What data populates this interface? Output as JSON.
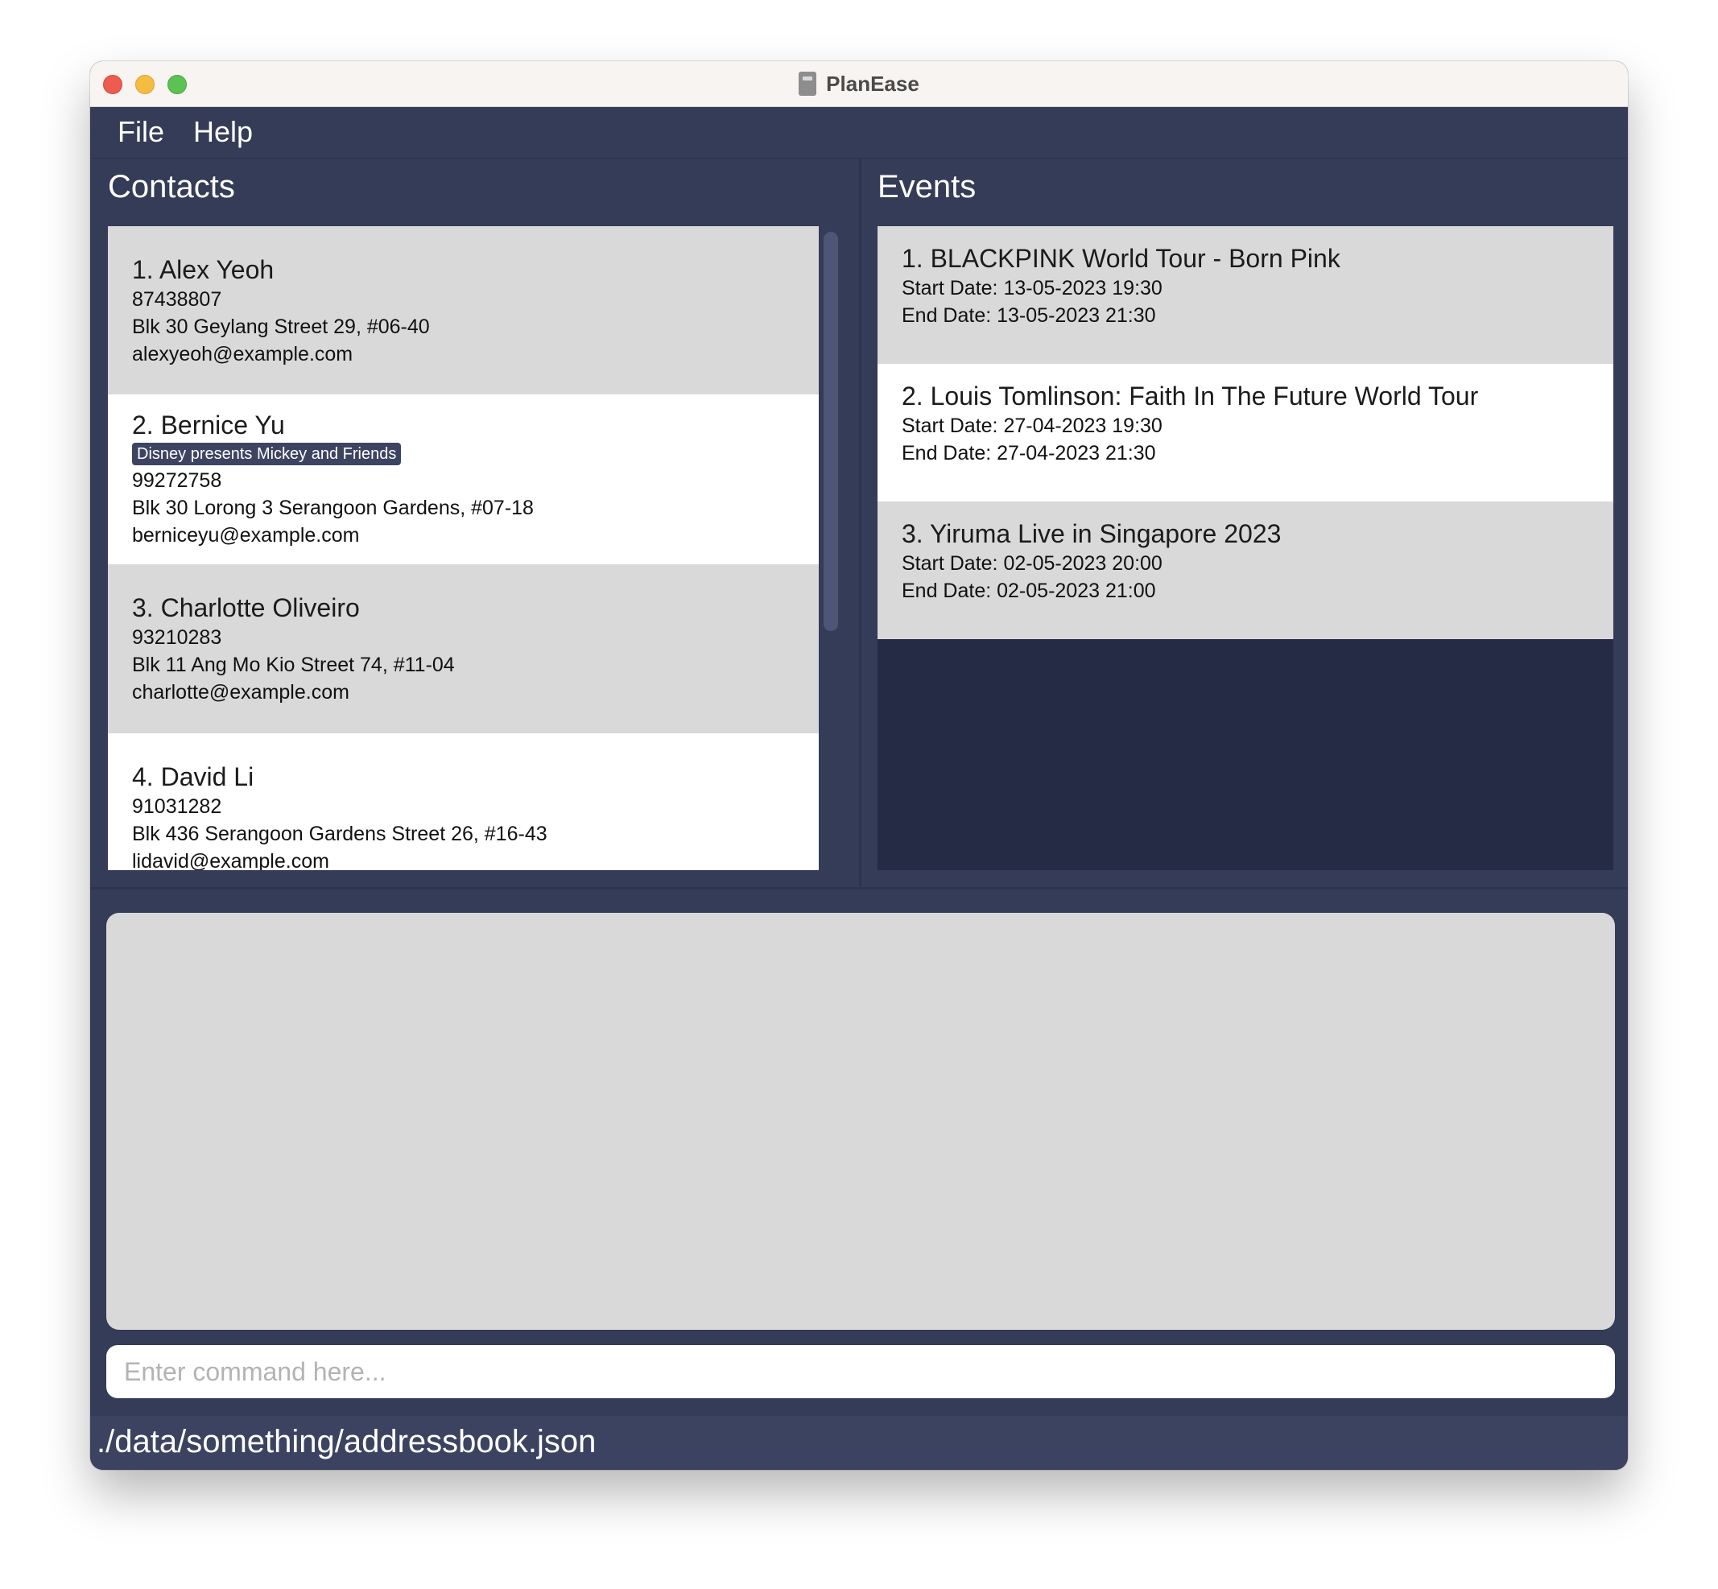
{
  "window": {
    "title": "PlanEase"
  },
  "menu": {
    "file": "File",
    "help": "Help"
  },
  "contacts": {
    "title": "Contacts",
    "items": [
      {
        "name": "1.  Alex Yeoh",
        "tag": "",
        "phone": "87438807",
        "address": "Blk 30 Geylang Street 29, #06-40",
        "email": "alexyeoh@example.com"
      },
      {
        "name": "2.  Bernice Yu",
        "tag": "Disney presents Mickey and Friends",
        "phone": "99272758",
        "address": "Blk 30 Lorong 3 Serangoon Gardens, #07-18",
        "email": "berniceyu@example.com"
      },
      {
        "name": "3.  Charlotte Oliveiro",
        "tag": "",
        "phone": "93210283",
        "address": "Blk 11 Ang Mo Kio Street 74, #11-04",
        "email": "charlotte@example.com"
      },
      {
        "name": "4.  David Li",
        "tag": "",
        "phone": "91031282",
        "address": "Blk 436 Serangoon Gardens Street 26, #16-43",
        "email": "lidavid@example.com"
      }
    ]
  },
  "events": {
    "title": "Events",
    "items": [
      {
        "name": "1.  BLACKPINK World Tour - Born Pink",
        "start": "Start Date: 13-05-2023 19:30",
        "end": "End Date: 13-05-2023 21:30"
      },
      {
        "name": "2.  Louis Tomlinson: Faith In The Future World Tour",
        "start": "Start Date: 27-04-2023 19:30",
        "end": "End Date: 27-04-2023 21:30"
      },
      {
        "name": "3.  Yiruma Live in Singapore 2023",
        "start": "Start Date: 02-05-2023 20:00",
        "end": "End Date: 02-05-2023 21:00"
      }
    ]
  },
  "result": {
    "text": ""
  },
  "command": {
    "placeholder": "Enter command here...",
    "value": ""
  },
  "status": {
    "path": "./data/something/addressbook.json"
  }
}
